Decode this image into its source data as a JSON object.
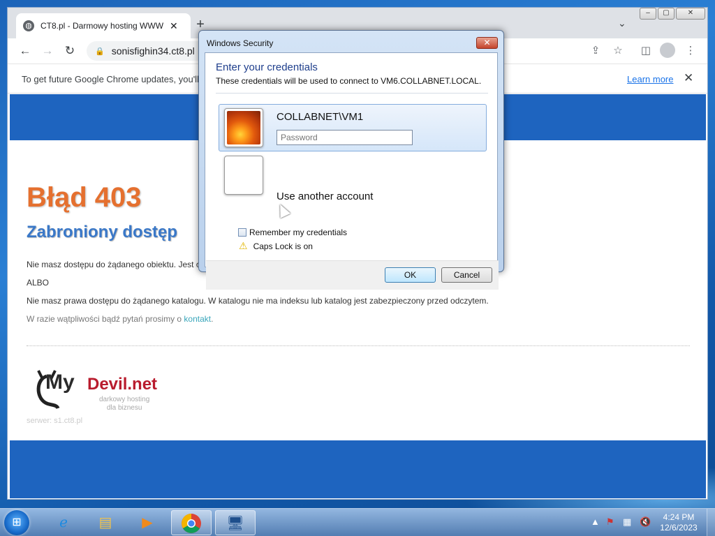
{
  "browser": {
    "tab_title": "CT8.pl - Darmowy hosting WWW",
    "tab_close": "✕",
    "new_tab": "+",
    "url": "sonisfighin34.ct8.pl",
    "infobar_message": "To get future Google Chrome updates, you'll",
    "learn_more": "Learn more",
    "infobar_close": "✕"
  },
  "page": {
    "error_title": "Błąd 403",
    "error_subtitle": "Zabroniony dostęp",
    "para1": "Nie masz dostępu do żądanego obiektu. Jest o",
    "para_or": "ALBO",
    "para2": "Nie masz prawa dostępu do żądanego katalogu. W katalogu nie ma indeksu lub katalog jest zabezpieczony przed odczytem.",
    "para3_prefix": "W razie wątpliwości bądź pytań prosimy o ",
    "contact_link": "kontakt",
    "para3_suffix": ".",
    "logo_my": "My",
    "logo_devil": "Devil.net",
    "logo_tagline": "darkowy hosting\ndla biznesu",
    "server": "serwer: s1.ct8.pl"
  },
  "dialog": {
    "window_title": "Windows Security",
    "close": "✕",
    "heading": "Enter your credentials",
    "description": "These credentials will be used to connect to VM6.COLLABNET.LOCAL.",
    "username": "COLLABNET\\VM1",
    "password_placeholder": "Password",
    "other_account": "Use another account",
    "remember": "Remember my credentials",
    "caps_lock": "Caps Lock is on",
    "ok": "OK",
    "cancel": "Cancel"
  },
  "taskbar": {
    "time": "4:24 PM",
    "date": "12/6/2023",
    "items": [
      "internet-explorer-icon",
      "file-explorer-icon",
      "media-player-icon",
      "chrome-icon",
      "remote-desktop-icon"
    ]
  },
  "colors": {
    "error_orange": "#e5702f",
    "subtitle_blue": "#3a78c8",
    "page_band_blue": "#1e64bf",
    "link_teal": "#3aa6bb"
  }
}
